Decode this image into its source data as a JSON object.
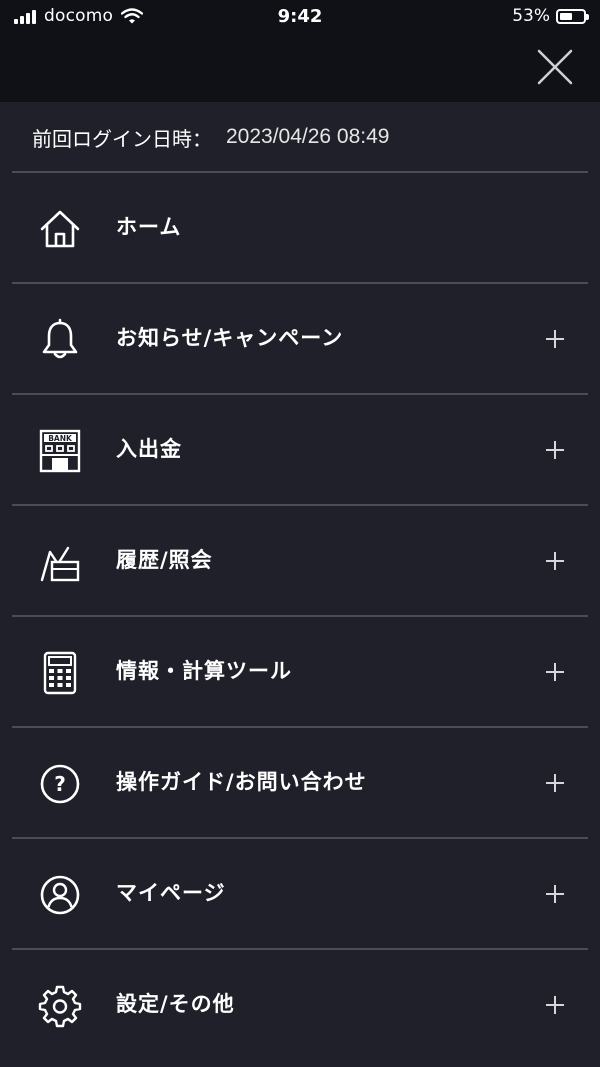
{
  "status_bar": {
    "carrier": "docomo",
    "time": "9:42",
    "battery": "53%",
    "battery_level": 0.53
  },
  "header": {
    "close_icon": "close-icon"
  },
  "login": {
    "label": "前回ログイン日時：",
    "value": "2023/04/26 08:49"
  },
  "menu": {
    "items": [
      {
        "label": "ホーム",
        "icon": "home-icon",
        "expandable": false
      },
      {
        "label": "お知らせ/キャンペーン",
        "icon": "bell-icon",
        "expandable": true
      },
      {
        "label": "入出金",
        "icon": "bank-icon",
        "expandable": true
      },
      {
        "label": "履歴/照会",
        "icon": "history-icon",
        "expandable": true
      },
      {
        "label": "情報・計算ツール",
        "icon": "calculator-icon",
        "expandable": true
      },
      {
        "label": "操作ガイド/お問い合わせ",
        "icon": "help-icon",
        "expandable": true
      },
      {
        "label": "マイページ",
        "icon": "user-icon",
        "expandable": true
      },
      {
        "label": "設定/その他",
        "icon": "gear-icon",
        "expandable": true
      }
    ]
  },
  "colors": {
    "background": "#1f2029",
    "header_background": "#101116",
    "divider": "#4a4c57",
    "text": "#ffffff"
  }
}
